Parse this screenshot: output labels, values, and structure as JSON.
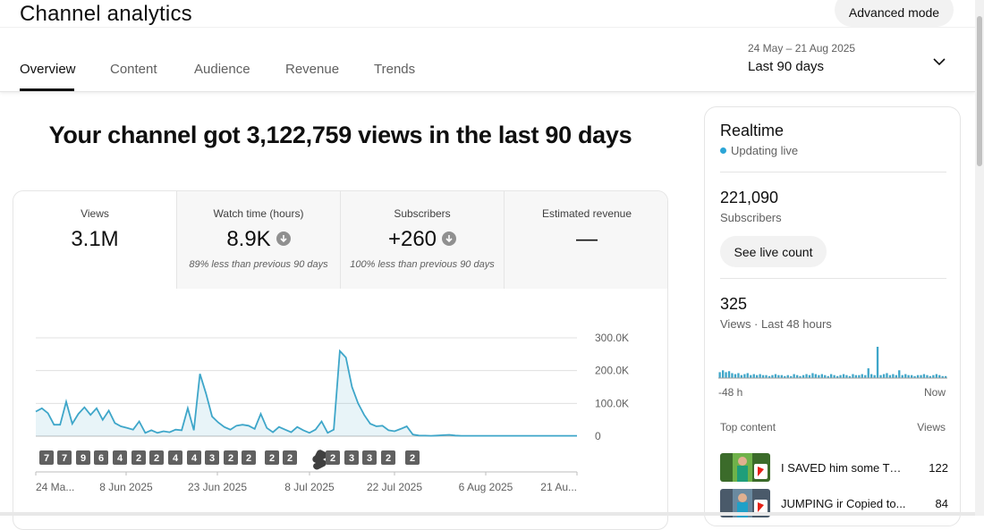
{
  "header": {
    "title": "Channel analytics",
    "advanced_mode_label": "Advanced mode",
    "date_range": "24 May – 21 Aug 2025",
    "date_label": "Last 90 days"
  },
  "tabs": [
    {
      "label": "Overview",
      "active": true
    },
    {
      "label": "Content",
      "active": false
    },
    {
      "label": "Audience",
      "active": false
    },
    {
      "label": "Revenue",
      "active": false
    },
    {
      "label": "Trends",
      "active": false
    }
  ],
  "headline": "Your channel got 3,122,759 views in the last 90 days",
  "metrics": [
    {
      "label": "Views",
      "value": "3.1M",
      "note": "",
      "selected": true
    },
    {
      "label": "Watch time (hours)",
      "value": "8.9K",
      "note": "89% less than previous 90 days",
      "selected": false
    },
    {
      "label": "Subscribers",
      "value": "+260",
      "note": "100% less than previous 90 days",
      "selected": false
    },
    {
      "label": "Estimated revenue",
      "value": "—",
      "note": "",
      "selected": false
    }
  ],
  "chart_data": {
    "type": "line",
    "x_tick_labels": [
      "24 Ma...",
      "8 Jun 2025",
      "23 Jun 2025",
      "8 Jul 2025",
      "22 Jul 2025",
      "6 Aug 2025",
      "21 Au..."
    ],
    "y_tick_labels": [
      "300.0K",
      "200.0K",
      "100.0K",
      "0"
    ],
    "ylim": [
      0,
      300000
    ],
    "grid": true,
    "series": [
      {
        "color": "#3ea6c9",
        "values": [
          75000,
          85000,
          70000,
          35000,
          35000,
          105000,
          38000,
          68000,
          88000,
          65000,
          85000,
          50000,
          78000,
          40000,
          30000,
          25000,
          20000,
          45000,
          10000,
          18000,
          10000,
          15000,
          12000,
          20000,
          18000,
          85000,
          18000,
          190000,
          130000,
          60000,
          42000,
          28000,
          20000,
          32000,
          35000,
          32000,
          22000,
          68000,
          25000,
          12000,
          28000,
          20000,
          12000,
          28000,
          18000,
          10000,
          20000,
          45000,
          10000,
          20000,
          260000,
          240000,
          150000,
          100000,
          65000,
          38000,
          30000,
          32000,
          18000,
          15000,
          22000,
          30000,
          5000,
          2000,
          1500,
          1000,
          2000,
          3000,
          4000,
          2000,
          1000,
          1000,
          1000,
          1000,
          1000,
          1000,
          1000,
          1000,
          1000,
          1000,
          1000,
          1000,
          1000,
          1000,
          1000,
          1000,
          1000,
          1000,
          1000,
          1000
        ]
      }
    ]
  },
  "upload_markers": [
    {
      "label": "7"
    },
    {
      "label": "7"
    },
    {
      "label": "9"
    },
    {
      "label": "6"
    },
    {
      "label": "4"
    },
    {
      "label": "2"
    },
    {
      "label": "2"
    },
    {
      "label": "4"
    },
    {
      "label": "4"
    },
    {
      "label": "3"
    },
    {
      "label": "2"
    },
    {
      "label": "2"
    },
    {
      "label": "2"
    },
    {
      "label": "2"
    },
    {
      "label": "shorts"
    },
    {
      "label": "2"
    },
    {
      "label": "3"
    },
    {
      "label": "3"
    },
    {
      "label": "2"
    },
    {
      "label": "2"
    }
  ],
  "realtime": {
    "title": "Realtime",
    "status": "Updating live",
    "subscribers_value": "221,090",
    "subscribers_label": "Subscribers",
    "live_count_label": "See live count",
    "views_value": "325",
    "views_label": "Views · Last 48 hours",
    "axis_start": "-48 h",
    "axis_end": "Now",
    "bars": [
      6,
      8,
      6,
      7,
      5,
      4,
      5,
      3,
      4,
      5,
      3,
      4,
      3,
      4,
      3,
      3,
      2,
      3,
      4,
      3,
      3,
      2,
      3,
      2,
      4,
      3,
      2,
      3,
      4,
      3,
      5,
      4,
      3,
      4,
      3,
      2,
      4,
      3,
      2,
      3,
      4,
      3,
      2,
      4,
      3,
      3,
      4,
      3,
      10,
      4,
      3,
      32,
      3,
      4,
      5,
      3,
      4,
      3,
      8,
      3,
      4,
      3,
      3,
      2,
      3,
      3,
      4,
      3,
      2,
      3,
      4,
      3,
      2,
      2
    ],
    "top_content_label": "Top content",
    "views_col_label": "Views",
    "top_content": [
      {
        "title": "I SAVED him some TOILET...",
        "views": "122"
      },
      {
        "title": "JUMPING ir Copied 󠁧to...",
        "views": "84"
      }
    ]
  },
  "colors": {
    "accent": "#3ea6c9",
    "live_dot": "#2ba5d6",
    "marker": "#606060"
  }
}
